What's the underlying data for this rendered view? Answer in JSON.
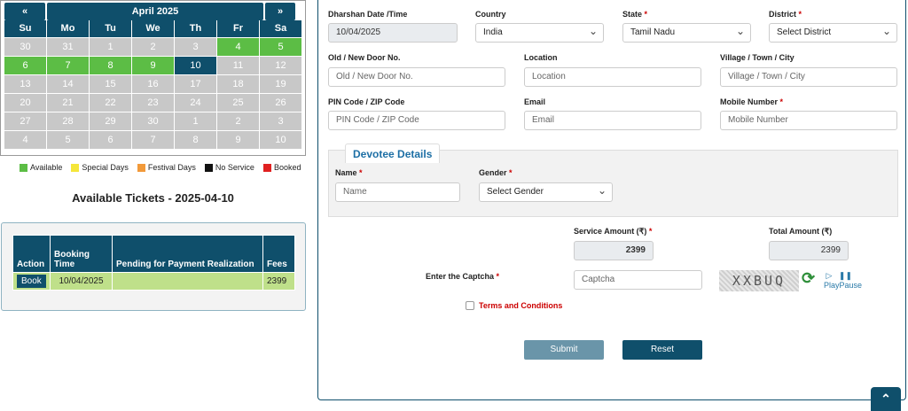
{
  "calendar": {
    "prev": "«",
    "next": "»",
    "month": "April 2025",
    "weekdays": [
      "Su",
      "Mo",
      "Tu",
      "We",
      "Th",
      "Fr",
      "Sa"
    ],
    "days": [
      {
        "d": "30",
        "s": "gray"
      },
      {
        "d": "31",
        "s": "gray"
      },
      {
        "d": "1",
        "s": "gray"
      },
      {
        "d": "2",
        "s": "gray"
      },
      {
        "d": "3",
        "s": "gray"
      },
      {
        "d": "4",
        "s": "green"
      },
      {
        "d": "5",
        "s": "green"
      },
      {
        "d": "6",
        "s": "green"
      },
      {
        "d": "7",
        "s": "green"
      },
      {
        "d": "8",
        "s": "green"
      },
      {
        "d": "9",
        "s": "green"
      },
      {
        "d": "10",
        "s": "sel"
      },
      {
        "d": "11",
        "s": "gray"
      },
      {
        "d": "12",
        "s": "gray"
      },
      {
        "d": "13",
        "s": "gray"
      },
      {
        "d": "14",
        "s": "gray"
      },
      {
        "d": "15",
        "s": "gray"
      },
      {
        "d": "16",
        "s": "gray"
      },
      {
        "d": "17",
        "s": "gray"
      },
      {
        "d": "18",
        "s": "gray"
      },
      {
        "d": "19",
        "s": "gray"
      },
      {
        "d": "20",
        "s": "gray"
      },
      {
        "d": "21",
        "s": "gray"
      },
      {
        "d": "22",
        "s": "gray"
      },
      {
        "d": "23",
        "s": "gray"
      },
      {
        "d": "24",
        "s": "gray"
      },
      {
        "d": "25",
        "s": "gray"
      },
      {
        "d": "26",
        "s": "gray"
      },
      {
        "d": "27",
        "s": "gray"
      },
      {
        "d": "28",
        "s": "gray"
      },
      {
        "d": "29",
        "s": "gray"
      },
      {
        "d": "30",
        "s": "gray"
      },
      {
        "d": "1",
        "s": "gray"
      },
      {
        "d": "2",
        "s": "gray"
      },
      {
        "d": "3",
        "s": "gray"
      },
      {
        "d": "4",
        "s": "gray"
      },
      {
        "d": "5",
        "s": "gray"
      },
      {
        "d": "6",
        "s": "gray"
      },
      {
        "d": "7",
        "s": "gray"
      },
      {
        "d": "8",
        "s": "gray"
      },
      {
        "d": "9",
        "s": "gray"
      },
      {
        "d": "10",
        "s": "gray"
      }
    ]
  },
  "legend": [
    {
      "label": "Available",
      "color": "#5cbd45"
    },
    {
      "label": "Special Days",
      "color": "#f5e63a"
    },
    {
      "label": "Festival Days",
      "color": "#f29a3a"
    },
    {
      "label": "No Service",
      "color": "#111111"
    },
    {
      "label": "Booked",
      "color": "#e02020"
    }
  ],
  "available_title": "Available Tickets - 2025-04-10",
  "tickets": {
    "headers": [
      "Action",
      "Booking Time",
      "Pending for Payment Realization",
      "Fees"
    ],
    "row": {
      "action": "Book",
      "time": "10/04/2025",
      "pending": "",
      "fees": "2399"
    }
  },
  "form": {
    "date_label": "Dharshan Date /Time",
    "date_value": "10/04/2025",
    "country_label": "Country",
    "country_value": "India",
    "state_label": "State",
    "state_value": "Tamil Nadu",
    "district_label": "District",
    "district_value": "Select District",
    "door_label": "Old / New Door No.",
    "door_placeholder": "Old / New Door No.",
    "location_label": "Location",
    "location_placeholder": "Location",
    "village_label": "Village / Town / City",
    "village_placeholder": "Village / Town / City",
    "pin_label": "PIN Code / ZIP Code",
    "pin_placeholder": "PIN Code / ZIP Code",
    "email_label": "Email",
    "email_placeholder": "Email",
    "mobile_label": "Mobile Number",
    "mobile_placeholder": "Mobile Number",
    "required_mark": "*",
    "devotee_title": "Devotee Details",
    "name_label": "Name",
    "name_placeholder": "Name",
    "gender_label": "Gender",
    "gender_value": "Select Gender",
    "service_label": "Service Amount (₹)",
    "service_value": "2399",
    "total_label": "Total Amount (₹)",
    "total_value": "2399",
    "captcha_label": "Enter the Captcha",
    "captcha_placeholder": "Captcha",
    "captcha_text": "XXBUQ",
    "play_pause": "PlayPause",
    "terms": "Terms and Conditions",
    "submit": "Submit",
    "reset": "Reset"
  }
}
